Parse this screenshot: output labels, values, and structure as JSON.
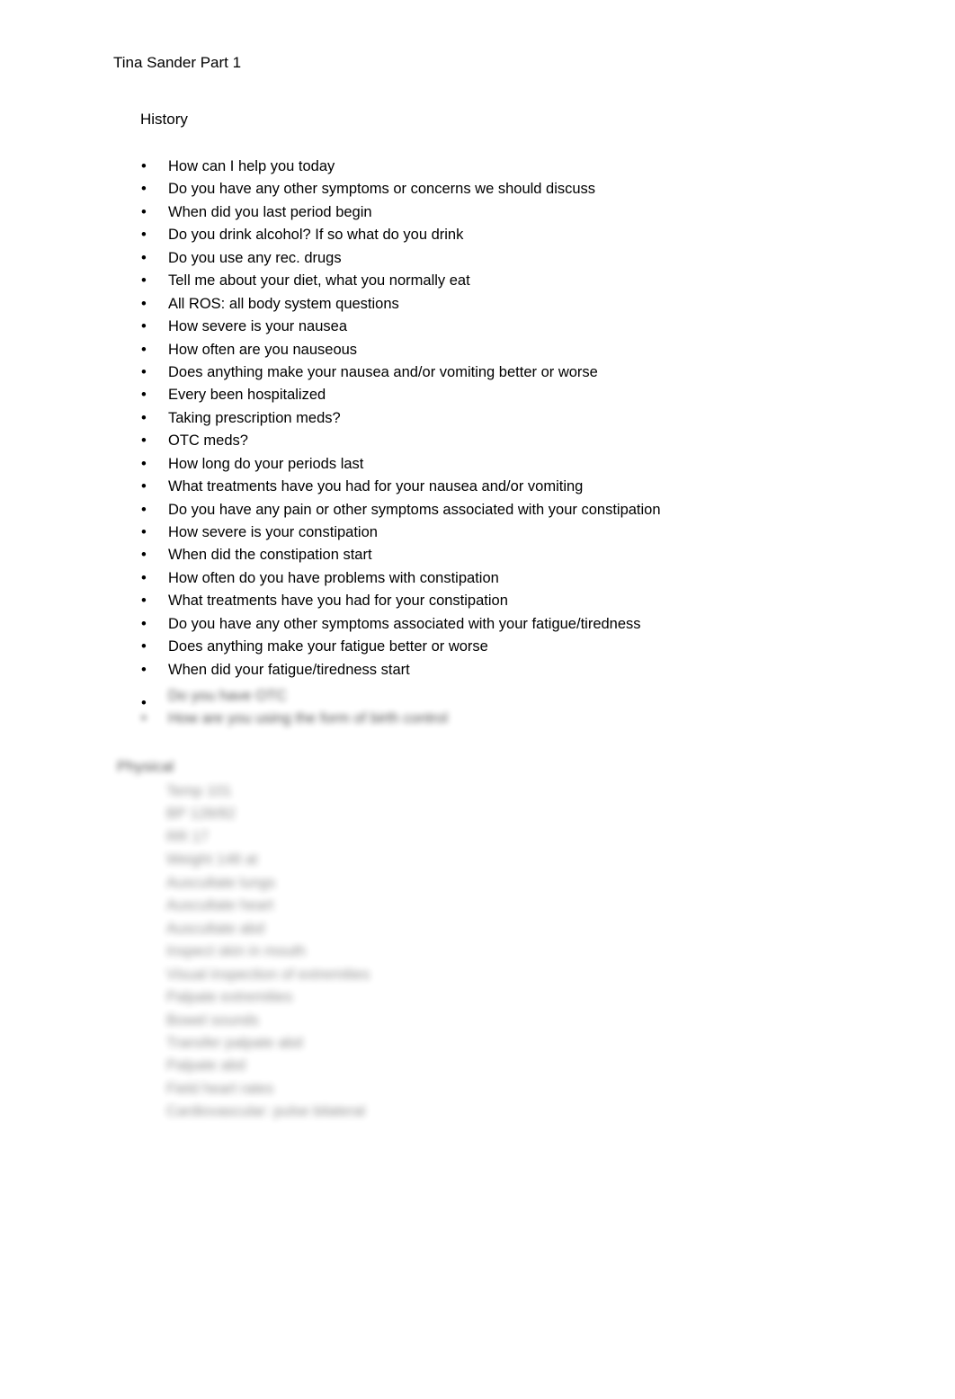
{
  "document": {
    "title": "Tina Sander Part 1",
    "background_color": "#ffffff",
    "text_color": "#000000"
  },
  "section": {
    "heading": "History"
  },
  "bullets": [
    {
      "marker": "•",
      "text": "How can I help you today"
    },
    {
      "marker": "•",
      "text": "Do you have any other symptoms or concerns we should discuss"
    },
    {
      "marker": "•",
      "text": "When did you last period begin"
    },
    {
      "marker": "•",
      "text": "Do you drink alcohol? If so what do you drink"
    },
    {
      "marker": "•",
      "text": "Do you use any rec. drugs"
    },
    {
      "marker": "•",
      "text": "Tell me about your diet, what you normally eat"
    },
    {
      "marker": "•",
      "text": "All ROS: all body system questions"
    },
    {
      "marker": "•",
      "text": "How severe is your nausea"
    },
    {
      "marker": "•",
      "text": "How often are you nauseous"
    },
    {
      "marker": "•",
      "text": "Does anything make your nausea and/or vomiting better or worse"
    },
    {
      "marker": "•",
      "text": "Every been hospitalized"
    },
    {
      "marker": "•",
      "text": "Taking prescription meds?"
    },
    {
      "marker": "•",
      "text": "OTC meds?"
    },
    {
      "marker": "•",
      "text": "How long do your periods last"
    },
    {
      "marker": "•",
      "text": "What treatments have you had for your nausea and/or vomiting"
    },
    {
      "marker": "•",
      "text": "Do you have any pain or other symptoms associated with your constipation"
    },
    {
      "marker": "•",
      "text": "How severe is your constipation"
    },
    {
      "marker": "•",
      "text": "When did the constipation start"
    },
    {
      "marker": "•",
      "text": "How often do you have problems with constipation"
    },
    {
      "marker": "•",
      "text": "What treatments have you had for your constipation"
    },
    {
      "marker": "•",
      "text": "Do you have any other symptoms associated with your fatigue/tiredness"
    },
    {
      "marker": "•",
      "text": "Does anything make your fatigue better or worse"
    },
    {
      "marker": "•",
      "text": "When did your fatigue/tiredness start"
    }
  ],
  "obscured": {
    "note": "Lower portion of the page is blurred and illegible in the source image.",
    "crisp_marker": "•",
    "bullets": [
      {
        "marker": "•",
        "text": "Do you have OTC"
      },
      {
        "marker": "•",
        "text": "How are you using the form of birth control"
      }
    ],
    "heading": "Physical",
    "rows": [
      "Temp 101",
      "BP 128/82",
      "RR 17",
      "Weight 148 at",
      "Auscultate lungs",
      "Auscultate heart",
      "Auscultate abd",
      "Inspect skin in mouth",
      "Visual inspection of extremities",
      "Palpate extremities",
      "Bowel sounds",
      "Transfer palpate abd",
      "Palpate abd",
      "Field heart rates",
      "Cardiovascular: pulse bilateral"
    ]
  }
}
